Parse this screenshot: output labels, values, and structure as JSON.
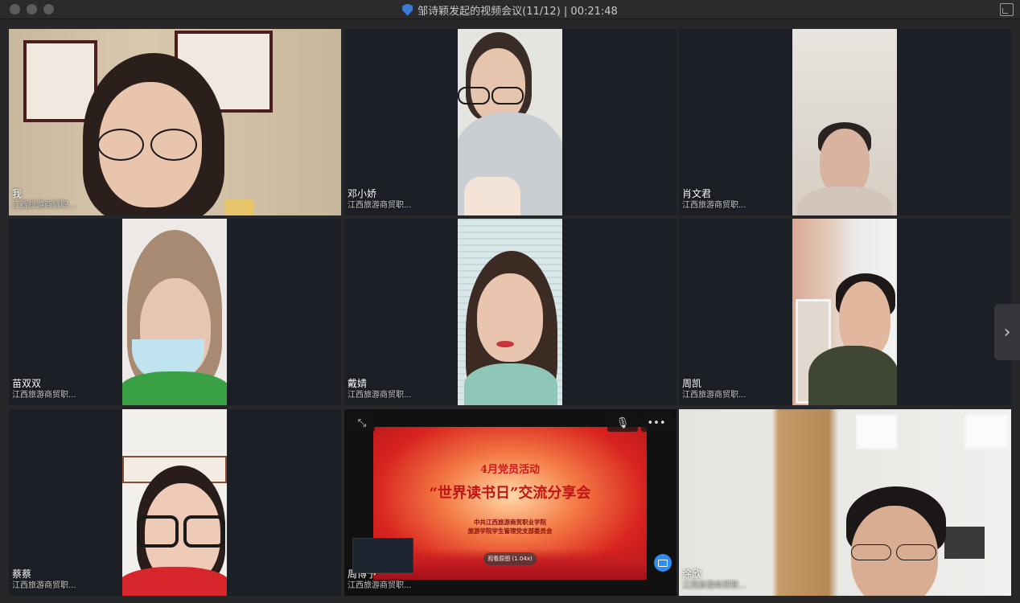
{
  "window": {
    "title": "邹诗颖发起的视频会议(11/12) | 00:21:48"
  },
  "participants": [
    {
      "name": "我",
      "org": "江西旅游商贸职..."
    },
    {
      "name": "邓小娇",
      "org": "江西旅游商贸职..."
    },
    {
      "name": "肖文君",
      "org": "江西旅游商贸职..."
    },
    {
      "name": "苗双双",
      "org": "江西旅游商贸职..."
    },
    {
      "name": "戴婧",
      "org": "江西旅游商贸职..."
    },
    {
      "name": "周凯",
      "org": "江西旅游商贸职..."
    },
    {
      "name": "蔡蔡",
      "org": "江西旅游商贸职..."
    },
    {
      "name": "周博予",
      "org": "江西旅游商贸职..."
    },
    {
      "name": "涂欣",
      "org": "江西旅游商贸职..."
    }
  ],
  "shared_screen": {
    "line1": "4月党员活动",
    "line2": "“世界读书日”交流分享会",
    "line3": "中共江西旅游商贸职业学院",
    "line4": "旅游学院学生管理党支部委员会",
    "pill": "观看原图 (1.04x)"
  },
  "icons": {
    "security": "shield-icon",
    "restore": "restore-window-icon",
    "next": "chevron-right-icon",
    "fullscreen": "expand-icon",
    "mic": "mic-off-icon",
    "more": "more-icon",
    "share": "screen-share-icon"
  },
  "colors": {
    "tile_bg": "#1c2026",
    "accent": "#2f8df0"
  }
}
